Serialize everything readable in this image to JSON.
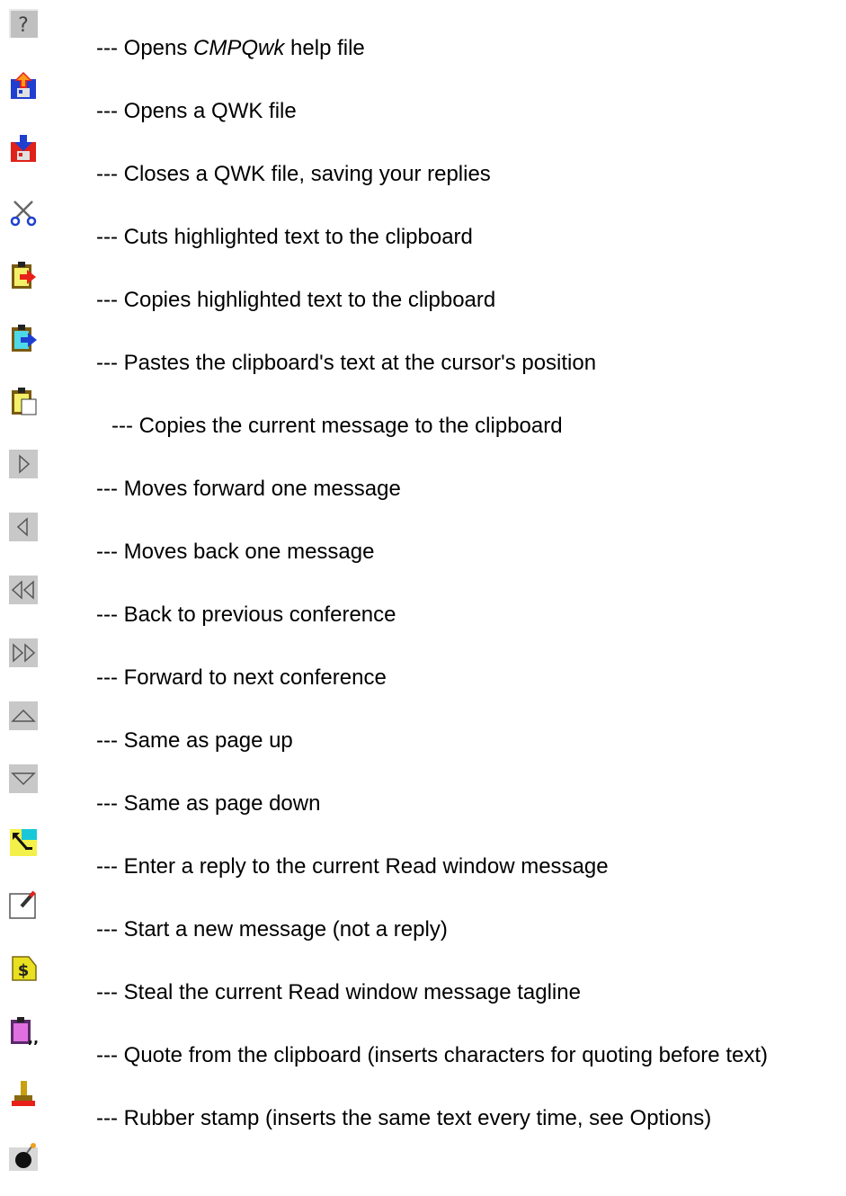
{
  "items": [
    {
      "icon": "help-icon",
      "prefix": "--- Opens ",
      "em": "CMPQwk",
      "suffix": " help file"
    },
    {
      "icon": "open-qwk-icon",
      "text": "--- Opens a QWK file"
    },
    {
      "icon": "close-qwk-icon",
      "text": "--- Closes a QWK file, saving your replies"
    },
    {
      "icon": "scissors-icon",
      "text": "--- Cuts highlighted text to the clipboard"
    },
    {
      "icon": "clipboard-copy-icon",
      "text": "--- Copies highlighted text to the clipboard"
    },
    {
      "icon": "clipboard-paste-icon",
      "text": "--- Pastes the clipboard's text at the cursor's position"
    },
    {
      "icon": "clipboard-message-icon",
      "text": "--- Copies the current message to the clipboard"
    },
    {
      "icon": "next-message-icon",
      "text": "--- Moves forward one message"
    },
    {
      "icon": "previous-message-icon",
      "text": "--- Moves back one message"
    },
    {
      "icon": "previous-conference-icon",
      "text": "--- Back to previous conference"
    },
    {
      "icon": "next-conference-icon",
      "text": "--- Forward to next conference"
    },
    {
      "icon": "page-up-icon",
      "text": "--- Same as page up"
    },
    {
      "icon": "page-down-icon",
      "text": "--- Same as page down"
    },
    {
      "icon": "reply-icon",
      "text": "--- Enter a reply to the current Read window message"
    },
    {
      "icon": "new-message-icon",
      "text": "--- Start a new message (not a reply)"
    },
    {
      "icon": "steal-tagline-icon",
      "text": "--- Steal the current Read window message tagline"
    },
    {
      "icon": "quote-clipboard-icon",
      "text": "--- Quote from the clipboard (inserts characters for quoting before text)"
    },
    {
      "icon": "rubber-stamp-icon",
      "text": "--- Rubber stamp (inserts the same text every time, see Options)"
    },
    {
      "icon": "bomb-icon"
    }
  ]
}
